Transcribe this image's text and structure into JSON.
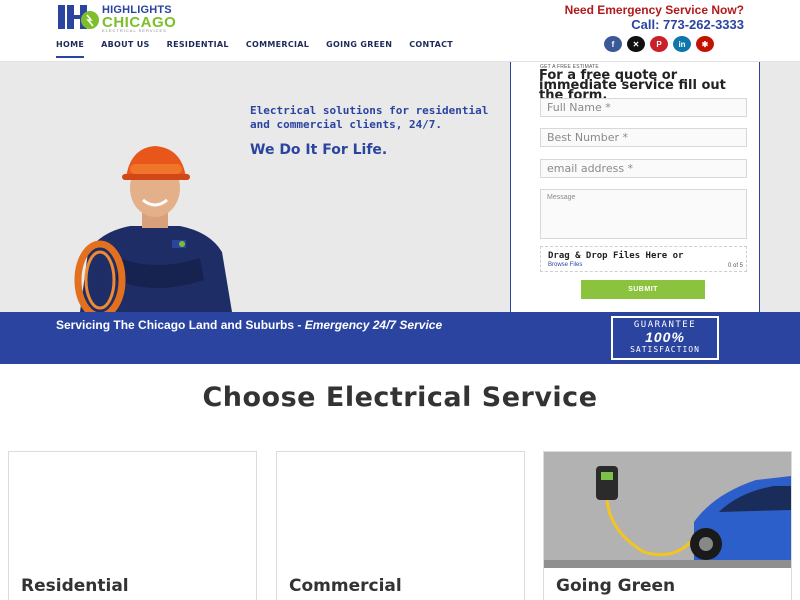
{
  "header": {
    "logo_line1": "HIGHLIGHTS",
    "logo_line2": "CHICAGO",
    "logo_tagline": "ELECTRICAL SERVICES",
    "need_service": "Need Emergency Service Now?",
    "call": "Call: 773-262-3333"
  },
  "nav": [
    {
      "label": "HOME",
      "active": true
    },
    {
      "label": "ABOUT US"
    },
    {
      "label": "RESIDENTIAL"
    },
    {
      "label": "COMMERCIAL"
    },
    {
      "label": "GOING GREEN"
    },
    {
      "label": "CONTACT"
    }
  ],
  "social": [
    {
      "icon": "facebook-icon",
      "glyph": "f",
      "color": "#3b5998"
    },
    {
      "icon": "x-icon",
      "glyph": "✕",
      "color": "#111111"
    },
    {
      "icon": "pinterest-icon",
      "glyph": "P",
      "color": "#cb2027"
    },
    {
      "icon": "linkedin-icon",
      "glyph": "in",
      "color": "#0e76a8"
    },
    {
      "icon": "yelp-icon",
      "glyph": "✱",
      "color": "#c41200"
    }
  ],
  "hero": {
    "line1": "Electrical solutions for residential and commercial clients, 24/7.",
    "tagline": "We Do It For Life."
  },
  "form": {
    "kicker": "GET A FREE ESTIMATE",
    "title": "For a free quote or immediate service fill out the form.",
    "name_placeholder": "Full Name *",
    "phone_placeholder": "Best Number *",
    "email_placeholder": "email address *",
    "message_placeholder": "Message",
    "upload_main": "Drag & Drop Files Here or",
    "upload_sub": "Browse Files",
    "upload_count": "0 of 5",
    "submit": "SUBMIT"
  },
  "band": {
    "text": "Servicing The Chicago Land and Suburbs - ",
    "emphasis": "Emergency 24/7 Service",
    "guarantee_top": "GUARANTEE",
    "guarantee_mid": "100%",
    "guarantee_bottom": "SATISFACTION"
  },
  "services": {
    "title": "Choose Electrical Service",
    "cards": [
      {
        "label": "Residential"
      },
      {
        "label": "Commercial"
      },
      {
        "label": "Going Green"
      }
    ]
  },
  "colors": {
    "brand_blue": "#2a44a0",
    "brand_green": "#8bc23e",
    "alert_red": "#b11a1a"
  }
}
